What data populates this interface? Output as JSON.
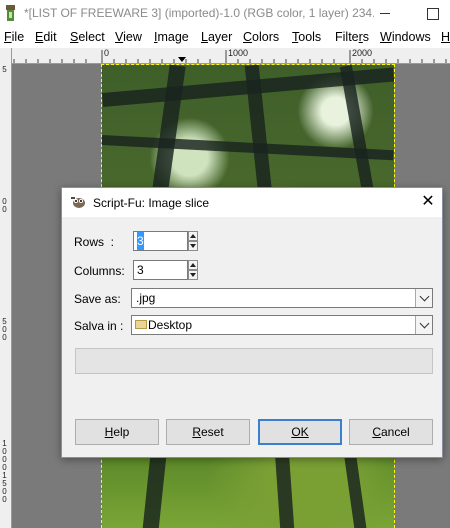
{
  "window": {
    "title": "*[LIST OF FREEWARE 3] (imported)-1.0 (RGB color, 1 layer) 234...",
    "minimize_glyph": "—",
    "maximize_glyph": "□"
  },
  "menu": {
    "items": [
      {
        "label": "File",
        "mnemonic": "F"
      },
      {
        "label": "Edit",
        "mnemonic": "E"
      },
      {
        "label": "Select",
        "mnemonic": "S"
      },
      {
        "label": "View",
        "mnemonic": "V"
      },
      {
        "label": "Image",
        "mnemonic": "I"
      },
      {
        "label": "Layer",
        "mnemonic": "L"
      },
      {
        "label": "Colors",
        "mnemonic": "C"
      },
      {
        "label": "Tools",
        "mnemonic": "T"
      },
      {
        "label": "Filters",
        "mnemonic": "r"
      },
      {
        "label": "Windows",
        "mnemonic": "W"
      },
      {
        "label": "H",
        "mnemonic": "H"
      }
    ]
  },
  "ruler": {
    "top_labels": [
      "0",
      "1000",
      "2000"
    ],
    "left_labels": [
      "5",
      "0",
      "0",
      "5",
      "0",
      "0",
      "1",
      "0",
      "0",
      "0",
      "1",
      "5",
      "0",
      "0"
    ]
  },
  "dialog": {
    "title": "Script-Fu: Image slice",
    "close_glyph": "✕",
    "rows": {
      "label": "Rows",
      "value": "3"
    },
    "columns": {
      "label": "Columns:",
      "value": "3"
    },
    "save_as": {
      "label": "Save as:",
      "value": ".jpg"
    },
    "save_in": {
      "label": "Salva in :",
      "value": "Desktop"
    },
    "progress_fraction": 0,
    "buttons": {
      "help": {
        "label": "Help",
        "mnemonic": "H"
      },
      "reset": {
        "label": "Reset",
        "mnemonic": "R"
      },
      "ok": {
        "label": "OK",
        "mnemonic": "O"
      },
      "cancel": {
        "label": "Cancel",
        "mnemonic": "C"
      }
    }
  },
  "colors": {
    "selection_highlight": "#3399ff",
    "default_button_border": "#3c7fd1",
    "selection_marching_ants": "#ffff00"
  }
}
